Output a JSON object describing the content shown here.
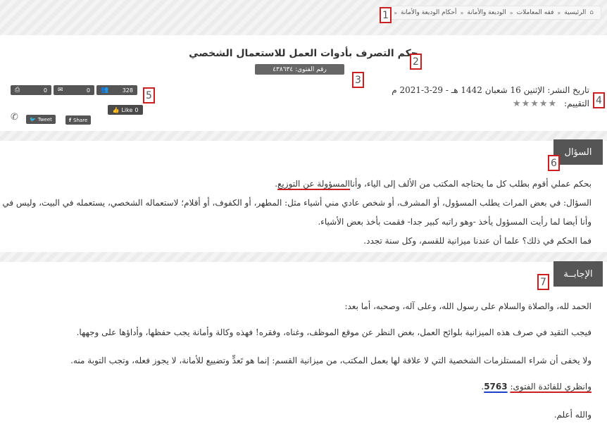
{
  "breadcrumb": {
    "items": [
      "الرئيسية",
      "فقه المعاملات",
      "الوديعة والأمانة",
      "أحكام الوديعة والأمانة"
    ]
  },
  "fatwa": {
    "title": "حكم التصرف بأدوات العمل للاستعمال الشخصي",
    "number_label": "رقم الفتوى: ٤٣٨٦٣٤"
  },
  "meta": {
    "publish_date": "تاريخ النشر: الإثنين 16 شعبان 1442 هـ - 29-3-2021 م",
    "rating_label": "التقييم:",
    "stars": "★★★★★"
  },
  "share": {
    "print_count": "0",
    "email_count": "0",
    "views_count": "328",
    "like_label": "Like",
    "like_count": "0",
    "tweet_label": "Tweet",
    "fb_share_label": "Share"
  },
  "question": {
    "heading": "السؤال",
    "lines": [
      "بحكم عملي أقوم بطلب كل ما يحتاجه المكتب من الألف إلى الياء، وأنا",
      "المسؤولة عن التوزيع",
      "السؤال: في بعض المرات يطلب المسؤول، أو المشرف، أو شخص عادي مني أشياء مثل: المطهر، أو الكفوف، أو أقلام؛ لاستعماله الشخصي، يستعمله في البيت، وليس في العمل.",
      "وأنا أيضا لما رأيت المسؤول يأخذ -وهو راتبه كبير جدا- فقمت بأخذ بعض الأشياء.",
      "فما الحكم في ذلك؟ علما أن عندنا ميزانية للقسم، وكل سنة تجدد."
    ]
  },
  "answer": {
    "heading": "الإجابــة",
    "lines": [
      "الحمد لله، والصلاة والسلام على رسول الله، وعلى آله، وصحبه، أما بعد:",
      "فيجب التقيد في صرف هذه الميزانية بلوائح العمل، بغض النظر عن موقع الموظف، وغناه، وفقره! فهذه وكالة وأمانة يجب حفظها، وأداؤها على وجهها.",
      "ولا يخفى أن شراء المستلزمات الشخصية التي لا علاقة لها بعمل المكتب، من ميزانية القسم: إنما هو تَعدٍّ وتضييع للأمانة، لا يجوز فعله، وتجب التوبة منه.",
      "وانظري للفائدة الفتوى:",
      "5763",
      "والله أعلم."
    ]
  },
  "annotations": [
    "1",
    "2",
    "3",
    "4",
    "5",
    "6",
    "7"
  ]
}
